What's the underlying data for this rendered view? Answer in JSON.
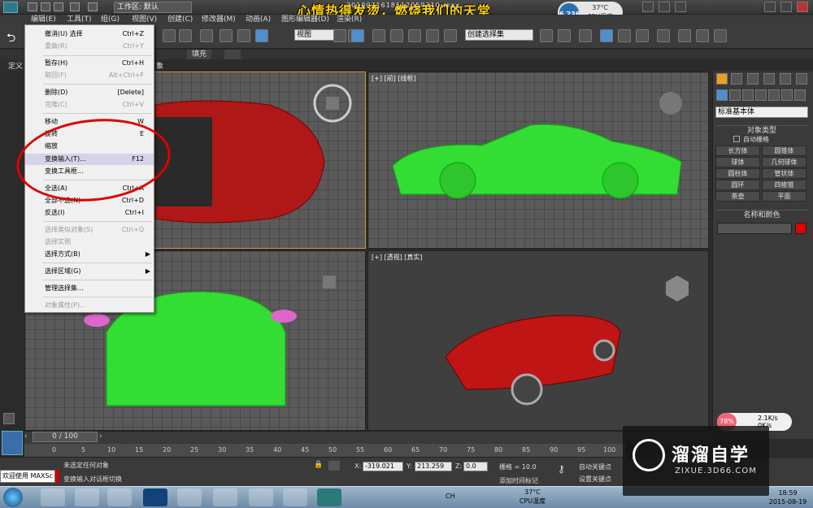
{
  "titlebar": {
    "workspace_label": "工作区: 默认",
    "overlay_text": "心情热得发烫，燃烧我们的天堂",
    "file_name": "2010071618512059310.max",
    "cpu_value": "6.236",
    "cpu_temp": "37°C",
    "cpu_label": "CPU温度"
  },
  "menubar": {
    "items": [
      "编辑(E)",
      "工具(T)",
      "组(G)",
      "视图(V)",
      "创建(C)",
      "修改器(M)",
      "动画(A)",
      "图形编辑器(D)",
      "渲染(R)"
    ]
  },
  "toolbar": {
    "view_dropdown": "视图",
    "selection_set": "创建选择集"
  },
  "ribbon": {
    "tabs": [
      "填充"
    ],
    "row2": [
      "定义",
      "象"
    ]
  },
  "edit_menu": {
    "items": [
      {
        "label": "撤消(U) 选择",
        "shortcut": "Ctrl+Z",
        "disabled": false
      },
      {
        "label": "重做(R)",
        "shortcut": "Ctrl+Y",
        "disabled": true
      },
      {
        "label": "暂存(H)",
        "shortcut": "Ctrl+H",
        "disabled": false
      },
      {
        "label": "取回(F)",
        "shortcut": "Alt+Ctrl+F",
        "disabled": true
      },
      {
        "label": "删除(D)",
        "shortcut": "[Delete]",
        "disabled": false
      },
      {
        "label": "克隆(C)",
        "shortcut": "Ctrl+V",
        "disabled": true
      },
      {
        "label": "移动",
        "shortcut": "W",
        "disabled": false
      },
      {
        "label": "旋转",
        "shortcut": "E",
        "disabled": false
      },
      {
        "label": "缩放",
        "shortcut": "",
        "disabled": false
      },
      {
        "label": "变换输入(T)...",
        "shortcut": "F12",
        "disabled": false,
        "highlighted": true
      },
      {
        "label": "变换工具框...",
        "shortcut": "",
        "disabled": false
      },
      {
        "label": "全选(A)",
        "shortcut": "Ctrl+A",
        "disabled": false
      },
      {
        "label": "全部不选(N)",
        "shortcut": "Ctrl+D",
        "disabled": false
      },
      {
        "label": "反选(I)",
        "shortcut": "Ctrl+I",
        "disabled": false
      },
      {
        "label": "选择类似对象(S)",
        "shortcut": "Ctrl+Q",
        "disabled": true
      },
      {
        "label": "选择实例",
        "shortcut": "",
        "disabled": true
      },
      {
        "label": "选择方式(B)",
        "shortcut": "",
        "disabled": false,
        "submenu": true
      },
      {
        "label": "选择区域(G)",
        "shortcut": "",
        "disabled": false,
        "submenu": true
      },
      {
        "label": "管理选择集...",
        "shortcut": "",
        "disabled": false
      },
      {
        "label": "对象属性(P)...",
        "shortcut": "",
        "disabled": true
      }
    ]
  },
  "viewports": {
    "front_label": "[+] [前] [线框]",
    "persp_label": "[+] [透视] [真实]"
  },
  "command_panel": {
    "dropdown": "标准基本体",
    "object_type_title": "对象类型",
    "autogrid": "自动栅格",
    "buttons": [
      "长方体",
      "圆锥体",
      "球体",
      "几何球体",
      "圆柱体",
      "管状体",
      "圆环",
      "四棱锥",
      "茶壶",
      "平面"
    ],
    "name_color_title": "名称和颜色",
    "object_color": "#e00000"
  },
  "timeline": {
    "slider": "0 / 100",
    "ticks": [
      "0",
      "5",
      "10",
      "15",
      "20",
      "25",
      "30",
      "35",
      "40",
      "45",
      "50",
      "55",
      "60",
      "65",
      "70",
      "75",
      "80",
      "85",
      "90",
      "95",
      "100"
    ]
  },
  "status": {
    "maxscript": "欢迎使用 MAXSc",
    "line1": "未选定任何对象",
    "line2": "变换输入对话框切换",
    "x_label": "X:",
    "x_value": "-319.021",
    "y_label": "Y:",
    "y_value": "213.259",
    "z_label": "Z:",
    "z_value": "0.0",
    "grid": "栅格 = 10.0",
    "add_time_tag": "添加时间标记",
    "auto_key": "自动关键点",
    "set_key": "设置关键点"
  },
  "taskbar": {
    "lang": "CH",
    "cpu_temp": "37°C",
    "cpu_label": "CPU温度",
    "time": "18:59",
    "date": "2015-08-19"
  },
  "netmon": {
    "percent": "78%",
    "up": "2.1K/s",
    "down": "0K/s"
  },
  "watermark": {
    "title": "溜溜自学",
    "url": "ZIXUE.3D66.COM"
  }
}
